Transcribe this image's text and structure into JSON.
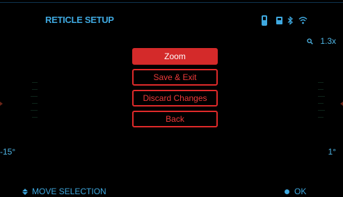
{
  "header": {
    "title": "RETICLE SETUP",
    "icons": [
      "phone-icon",
      "sd-card-icon",
      "bluetooth-icon",
      "wifi-icon"
    ]
  },
  "zoom": {
    "icon": "magnifier-icon",
    "value": "1.3x"
  },
  "angles": {
    "left": "-15°",
    "right": "1°"
  },
  "menu": {
    "items": [
      {
        "label": "Zoom",
        "selected": true
      },
      {
        "label": "Save & Exit",
        "selected": false
      },
      {
        "label": "Discard Changes",
        "selected": false
      },
      {
        "label": "Back",
        "selected": false
      }
    ]
  },
  "footer": {
    "move_label": "MOVE SELECTION",
    "ok_label": "OK"
  },
  "colors": {
    "accent": "#3fa9e0",
    "menu_border": "#e02a2a",
    "menu_selected_bg": "#d42a2a",
    "background": "#000000"
  }
}
